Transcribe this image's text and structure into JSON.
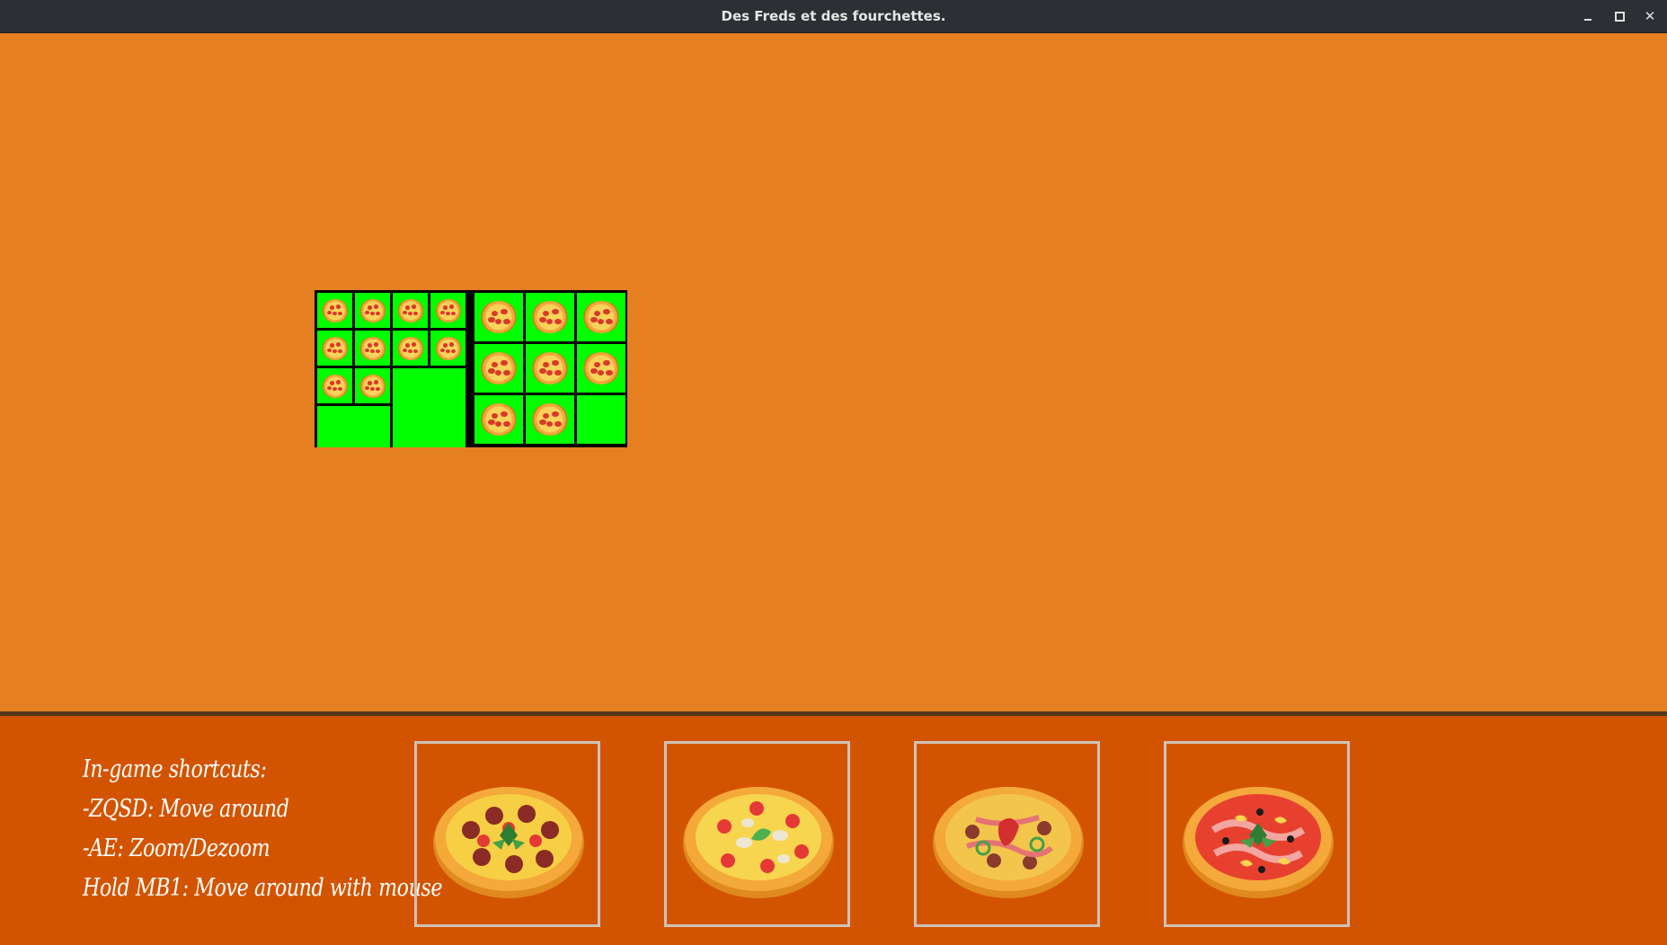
{
  "window": {
    "title": "Des Freds et des fourchettes."
  },
  "icons": {
    "minimize": "minimize-icon",
    "maximize": "maximize-icon",
    "close": "close-icon"
  },
  "colors": {
    "background": "#e67e22",
    "hud": "#d35400",
    "cell": "#00ff00",
    "cell_border": "#000000",
    "slot_border": "#cfc3b8"
  },
  "board": {
    "rooms": [
      {
        "name": "small-room",
        "grid": "4x4",
        "pizzas": 10
      },
      {
        "name": "large-room",
        "grid": "3x3",
        "pizzas": 8
      }
    ]
  },
  "hud": {
    "shortcuts": [
      "In-game shortcuts:",
      "-ZQSD: Move around",
      "-AE: Zoom/Dezoom",
      "Hold MB1: Move around with mouse"
    ],
    "pizza_slots": [
      {
        "type": "pepperoni-pizza-icon"
      },
      {
        "type": "veggie-pizza-icon"
      },
      {
        "type": "meat-pepper-pizza-icon"
      },
      {
        "type": "bacon-pineapple-pizza-icon"
      }
    ]
  }
}
